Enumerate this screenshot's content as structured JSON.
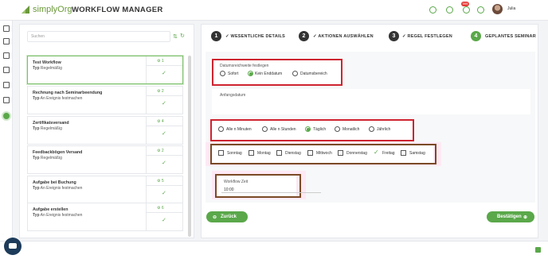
{
  "header": {
    "logo_text": "simplyOrg",
    "app_title": "WORKFLOW MANAGER",
    "user_name": "Julia",
    "notification_count": "999"
  },
  "search": {
    "placeholder": "Suchen"
  },
  "workflows": [
    {
      "name": "Test Workflow",
      "type_label": "Typ",
      "type_value": "Regelmäßig",
      "count": "1"
    },
    {
      "name": "Rechnung nach Seminarbeendung",
      "type_label": "Typ",
      "type_value": "An Ereignis festmachen",
      "count": "2"
    },
    {
      "name": "Zertifikatsversand",
      "type_label": "Typ",
      "type_value": "Regelmäßig",
      "count": "4"
    },
    {
      "name": "Feedbackbögen Versand",
      "type_label": "Typ",
      "type_value": "Regelmäßig",
      "count": "2"
    },
    {
      "name": "Aufgabe bei Buchung",
      "type_label": "Typ",
      "type_value": "An Ereignis festmachen",
      "count": "5"
    },
    {
      "name": "Aufgabe erstellen",
      "type_label": "Typ",
      "type_value": "An Ereignis festmachen",
      "count": "6"
    }
  ],
  "steps": [
    {
      "number": "1",
      "label": "WESENTLICHE DETAILS",
      "done": true
    },
    {
      "number": "2",
      "label": "AKTIONEN AUSWÄHLEN",
      "done": true
    },
    {
      "number": "3",
      "label": "REGEL FESTLEGEN",
      "done": true
    },
    {
      "number": "4",
      "label": "GEPLANTES SEMINAR",
      "done": false
    }
  ],
  "date_range": {
    "title": "Datumsreichweite festlegen",
    "options": [
      "Sofort",
      "Kein Enddatum",
      "Datumsbereich"
    ],
    "selected": "Kein Enddatum"
  },
  "start_date": {
    "label": "Anfangsdatum"
  },
  "frequency": {
    "options": [
      "Alle n Minuten",
      "Alle n Stunden",
      "Täglich",
      "Monatlich",
      "Jährlich"
    ],
    "selected": "Täglich"
  },
  "weekdays": {
    "options": [
      "Sonntag",
      "Montag",
      "Dienstag",
      "Mittwoch",
      "Donnerstag",
      "Freitag",
      "Samstag"
    ],
    "checked": [
      "Freitag"
    ]
  },
  "workflow_time": {
    "label": "Workflow Zeit",
    "value": "10:00"
  },
  "buttons": {
    "back": "Zurück",
    "confirm": "Bestätigen"
  },
  "colors": {
    "accent": "#5aa84a",
    "highlight_red": "#cf2430",
    "highlight_brown": "#7a4a26"
  }
}
